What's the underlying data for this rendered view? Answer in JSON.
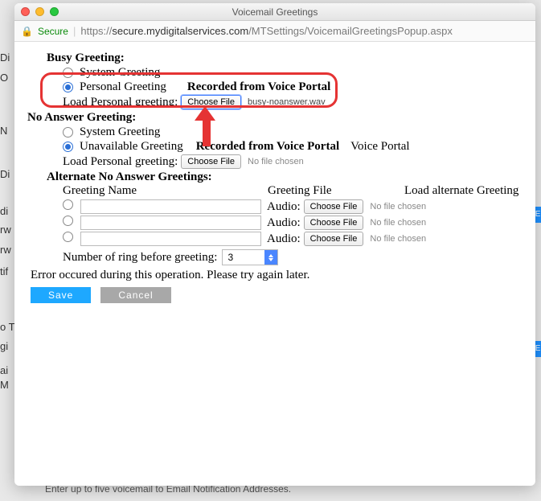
{
  "bg": {
    "t1": "Di",
    "t2": "O",
    "t3": "N",
    "t4": "Di",
    "t5": "di",
    "t6": "rw",
    "t7": "rw",
    "t8": "tif",
    "t9": "o T",
    "t10": "gi",
    "t11": "ai",
    "t12": "M",
    "blue1": "IE",
    "blue2": "IE",
    "footer": "Enter up to five voicemail to Email Notification Addresses."
  },
  "window": {
    "title": "Voicemail Greetings",
    "secure_label": "Secure",
    "url_prefix": "https://",
    "url_host": "secure.mydigitalservices.com",
    "url_path": "/MTSettings/VoicemailGreetingsPopup.aspx"
  },
  "busy": {
    "title": "Busy Greeting:",
    "system": "System Greeting",
    "personal": "Personal Greeting",
    "recorded": "Recorded from Voice Portal",
    "load_label": "Load Personal greeting:",
    "choose": "Choose File",
    "filename": "busy-noanswer.wav"
  },
  "noanswer": {
    "title": "No Answer Greeting:",
    "system": "System Greeting",
    "unavailable": "Unavailable Greeting",
    "recorded": "Recorded from Voice Portal",
    "vp": "Voice Portal",
    "load_label": "Load Personal greeting:",
    "choose": "Choose File",
    "filename": "No file chosen"
  },
  "alt": {
    "title": "Alternate No Answer Greetings:",
    "h_name": "Greeting Name",
    "h_file": "Greeting File",
    "h_load": "Load alternate Greeting",
    "audio": "Audio:",
    "choose": "Choose File",
    "nofile": "No file chosen",
    "ring_label": "Number of ring before greeting:",
    "ring_value": "3"
  },
  "error": "Error occured during this operation. Please try again later.",
  "buttons": {
    "save": "Save",
    "cancel": "Cancel"
  }
}
